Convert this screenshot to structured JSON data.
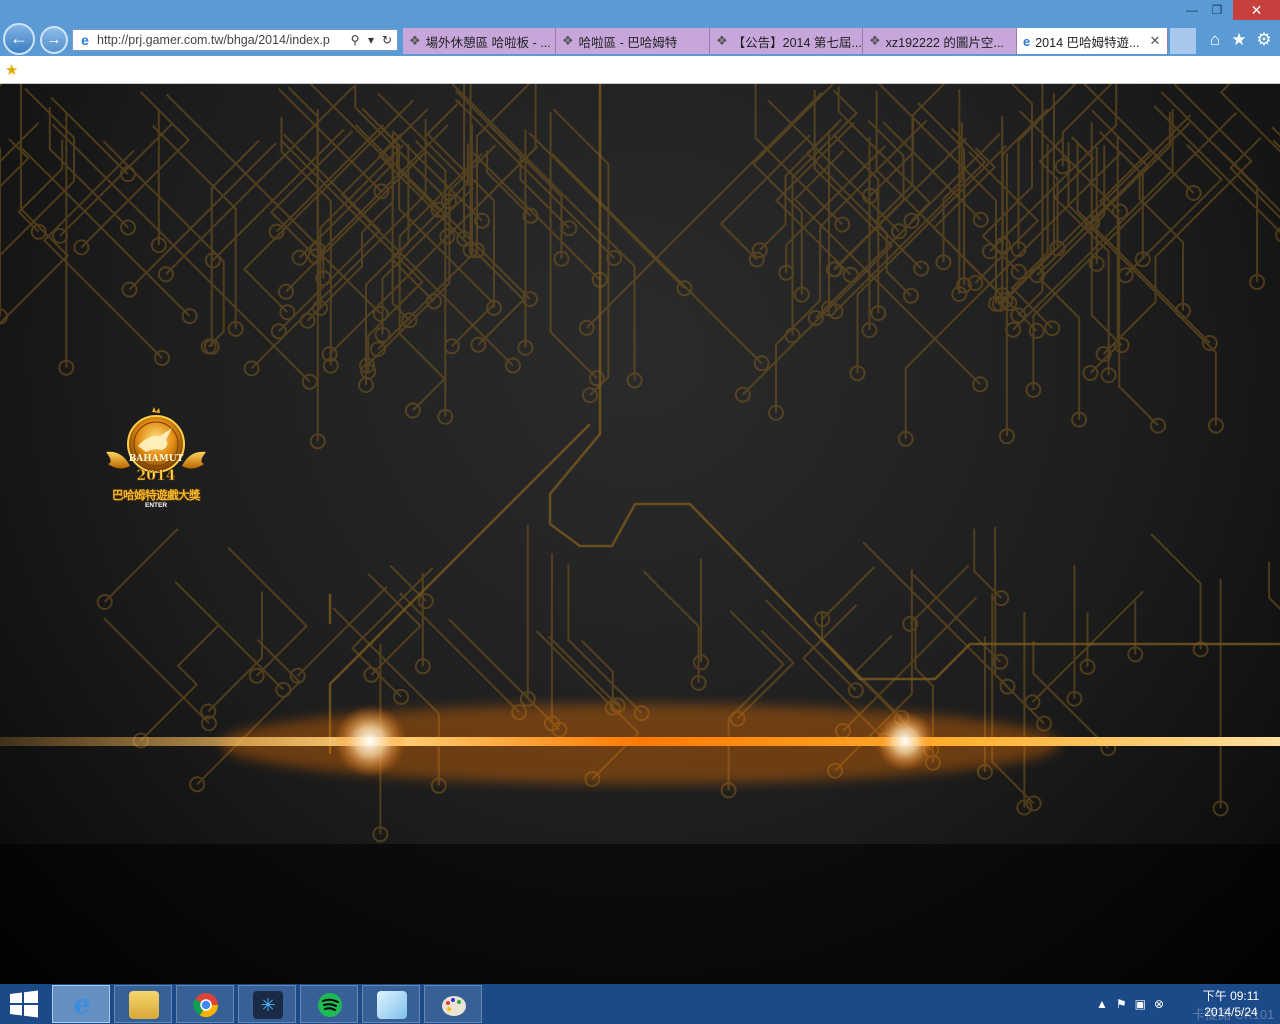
{
  "browser": {
    "address_bar": {
      "url": "http://prj.gamer.com.tw/bhga/2014/index.p"
    },
    "tabs": [
      {
        "label": "場外休憩區 哈啦板 - ..."
      },
      {
        "label": "哈啦區 - 巴哈姆特"
      },
      {
        "label": "【公告】2014 第七屆..."
      },
      {
        "label": "xz192222 的圖片空..."
      },
      {
        "label": "2014 巴哈姆特遊..."
      }
    ],
    "accent_color": "#5b9bd5",
    "tab_color": "#c7a6dc",
    "icons": [
      "back-arrow-icon",
      "forward-arrow-icon",
      "search-icon",
      "dropdown-icon",
      "refresh-icon",
      "home-icon",
      "favorites-star-icon",
      "gear-icon",
      "add-favorites-icon"
    ]
  },
  "page": {
    "logo": {
      "line1": "BAHAMUT",
      "year": "2014",
      "title": "巴哈姆特遊戲大獎",
      "enter": "ENTER"
    },
    "background_color": "#1d1d1d",
    "circuit_color": "#7a5a1e",
    "glow_color": "#ff7a00"
  },
  "taskbar": {
    "color": "#1c4a88",
    "apps": [
      "internet-explorer",
      "file-explorer",
      "chrome",
      "battlenet",
      "spotify",
      "notepad",
      "paint"
    ],
    "clock": {
      "time": "下午 09:11",
      "date": "2014/5/24"
    },
    "watermark": "卡提諾 CK101"
  }
}
